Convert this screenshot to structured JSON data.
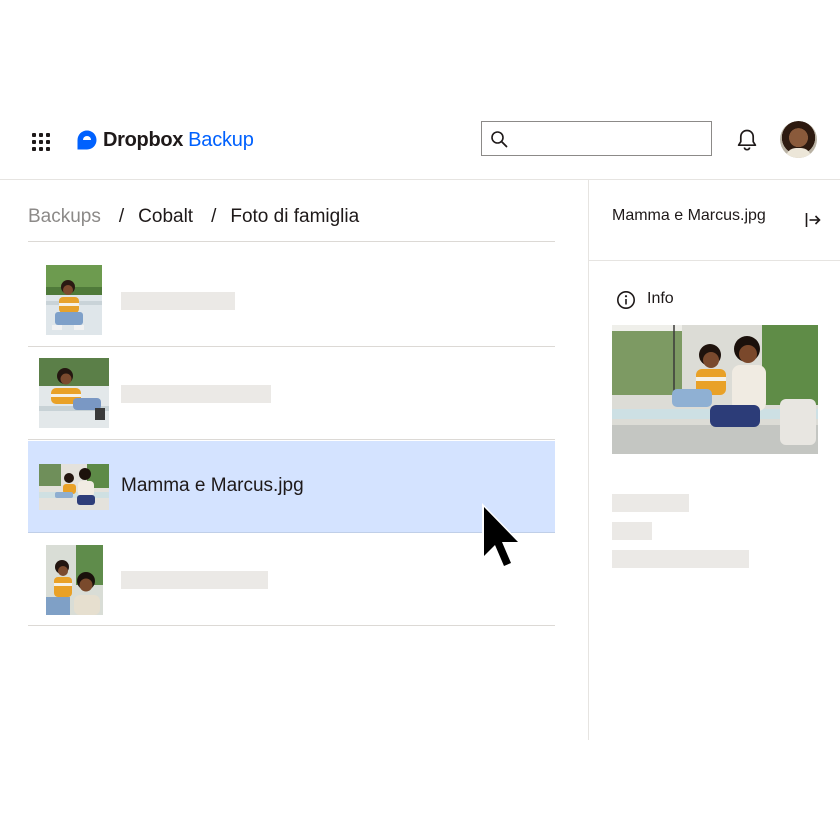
{
  "header": {
    "brand": "Dropbox",
    "brand_sub": "Backup",
    "search": {
      "value": "",
      "placeholder": ""
    }
  },
  "breadcrumb": [
    "Backups",
    "Cobalt",
    "Foto di famiglia"
  ],
  "breadcrumb_separator": "/",
  "files": [
    {
      "name": "",
      "selected": false,
      "thumb": "boy-on-porch-swing-photo"
    },
    {
      "name": "",
      "selected": false,
      "thumb": "boy-lying-on-swing-photo"
    },
    {
      "name": "Mamma e Marcus.jpg",
      "selected": true,
      "thumb": "mother-and-son-photo"
    },
    {
      "name": "",
      "selected": false,
      "thumb": "family-selfie-photo"
    }
  ],
  "details": {
    "title": "Mamma e Marcus.jpg",
    "section_label": "Info"
  },
  "colors": {
    "accent": "#0061fe",
    "selected_row": "#d4e3ff",
    "placeholder": "#ebe9e6",
    "text": "#1e1919"
  }
}
